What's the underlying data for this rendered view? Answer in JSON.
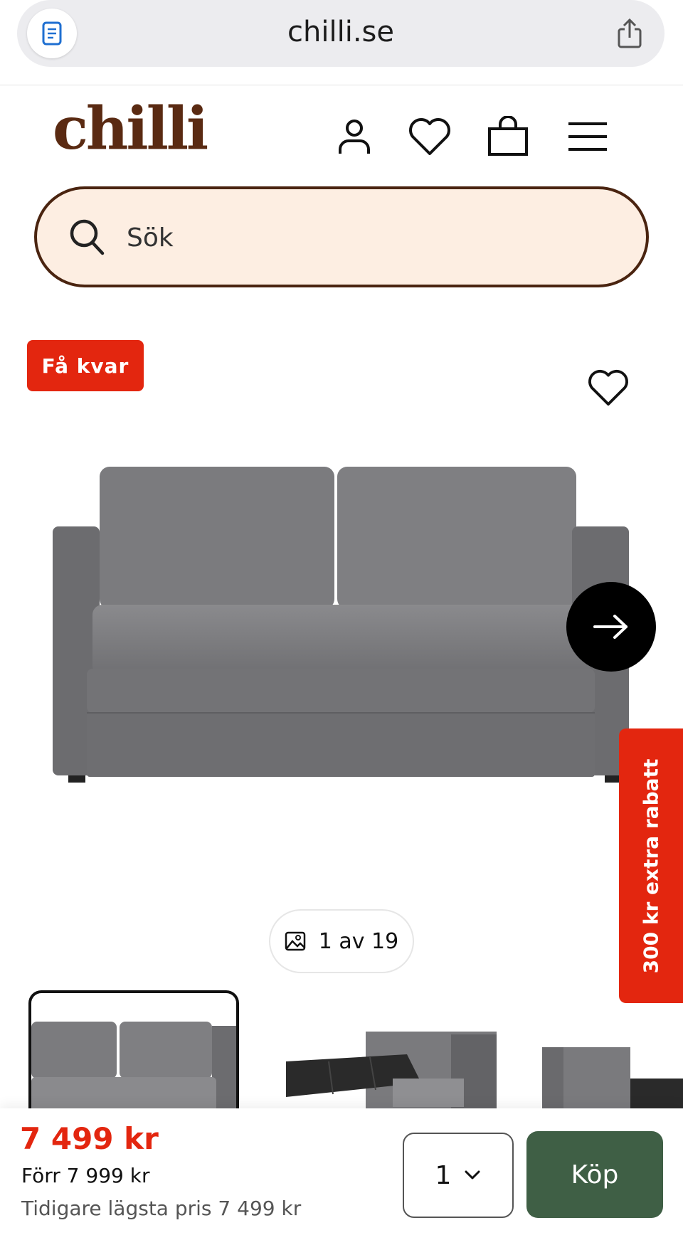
{
  "browser": {
    "url": "chilli.se",
    "icons": {
      "reader": "reader-mode-icon",
      "share": "share-icon"
    }
  },
  "header": {
    "logo_text": "chilli",
    "brand_color": "#5a2a12",
    "icons": [
      "account-icon",
      "heart-icon",
      "bag-icon",
      "menu-icon"
    ]
  },
  "search": {
    "placeholder": "Sök",
    "icon": "search-icon",
    "background": "#fdeee2",
    "border_color": "#4a2410"
  },
  "product": {
    "badge": "Få kvar",
    "badge_color": "#e3260f",
    "promo_tab": "300 kr extra rabatt",
    "image_counter": "1 av 19",
    "image_alt": "grey two-seat sofa bed",
    "thumbnail_count": 3,
    "selected_thumbnail": 1
  },
  "purchase": {
    "price": "7 499 kr",
    "previous_price": "Förr 7 999 kr",
    "lowest_price": "Tidigare lägsta pris 7 499 kr",
    "quantity": "1",
    "buy_label": "Köp",
    "buy_color": "#3f5f45",
    "price_color": "#e3260f"
  }
}
